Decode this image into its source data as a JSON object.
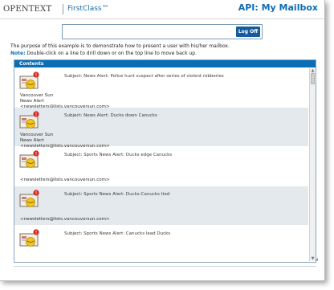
{
  "header": {
    "brand": "OPENTEXT",
    "product": "FirstClass™",
    "title": "API: My Mailbox"
  },
  "toolbar": {
    "search_value": "",
    "logoff_label": "Log Off"
  },
  "intro": {
    "line1": "The purpose of this example is to demonstrate how to present a user with his/her mailbox.",
    "note_label": "Note:",
    "note_text": "Double-click on a line to drill down or on the top line to move back up."
  },
  "contents": {
    "title": "Contents",
    "items": [
      {
        "subject": "Subject: News Alert: Police hunt suspect after series of violent robberies",
        "sender_name": "Vancouver Sun",
        "sender_list": "News Alert",
        "sender_email": "<newsletters@lists.vancouversun.com>",
        "badge": "!",
        "icon": "mail-envelope-icon"
      },
      {
        "subject": "Subject: News Alert: Ducks down Canucks",
        "sender_name": "Vancouver Sun",
        "sender_list": "News Alert",
        "sender_email": "<newsletters@lists.vancouversun.com>",
        "badge": "!",
        "icon": "mail-envelope-icon"
      },
      {
        "subject": "Subject: Sports News Alert: Ducks edge Canucks",
        "sender_name": "",
        "sender_list": "",
        "sender_email": "<newsletters@lists.vancouversun.com>",
        "badge": "!",
        "icon": "mail-envelope-icon"
      },
      {
        "subject": "Subject: Sports News Alert: Ducks-Canucks tied",
        "sender_name": "",
        "sender_list": "",
        "sender_email": "<newsletters@lists.vancouversun.com>",
        "badge": "!",
        "icon": "mail-envelope-icon"
      },
      {
        "subject": "Subject: Sports News Alert: Canucks lead Ducks",
        "sender_name": "",
        "sender_list": "",
        "sender_email": "",
        "badge": "!",
        "icon": "mail-envelope-icon"
      }
    ]
  },
  "colors": {
    "accent": "#0b6db4",
    "row_shade": "#e4e9ed",
    "badge": "#d9261c",
    "envelope_seal": "#f2c41c"
  }
}
